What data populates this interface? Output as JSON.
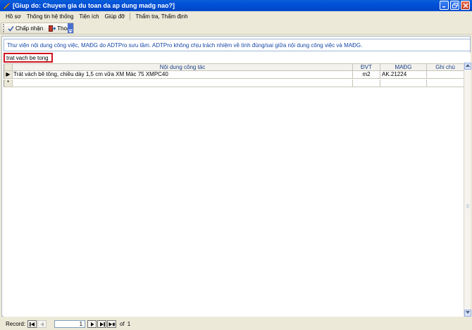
{
  "window": {
    "title": "[Giup do: Chuyen gia du toan da ap dung madg nao?]",
    "icon": "pencil-icon"
  },
  "menu": {
    "items": [
      "Hồ sơ",
      "Thông tin hệ thống",
      "Tiện ích",
      "Giúp đỡ",
      "Thẩm tra, Thẩm định"
    ]
  },
  "toolbar": {
    "accept_label": "Chấp nhận",
    "exit_label": "Thoát"
  },
  "notice": "Thư viện nội dung công việc, MAĐG do ADTPro sưu tầm. ADTPro không chịu trách nhiệm về tính đúng/sai giữa nội dung công việc và MAĐG.",
  "search": {
    "value": "trat vach be tong"
  },
  "grid": {
    "columns": [
      "Nội dung công tác",
      "ĐVT",
      "MAĐG",
      "Ghi chú"
    ],
    "rows": [
      [
        "Trát vách bê tông, chiều dày 1,5 cm vữa XM Mác 75 XMPC40",
        "m2",
        "AK.21224",
        ""
      ]
    ],
    "new_row_marker": "*",
    "current_row_marker": "▶"
  },
  "record_nav": {
    "label": "Record:",
    "current": "1",
    "of_text": "of",
    "total": "1"
  }
}
